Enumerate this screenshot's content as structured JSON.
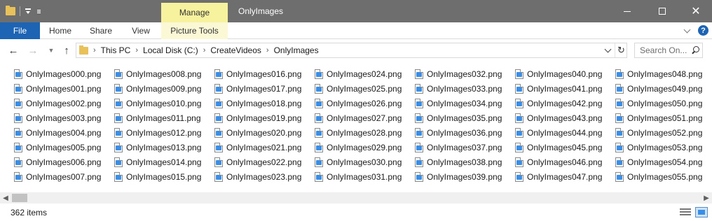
{
  "window": {
    "title": "OnlyImages",
    "contextual_tab_group": "Manage"
  },
  "ribbon": {
    "tabs": [
      "File",
      "Home",
      "Share",
      "View",
      "Picture Tools"
    ]
  },
  "navigation": {
    "breadcrumb": [
      "This PC",
      "Local Disk (C:)",
      "CreateVideos",
      "OnlyImages"
    ],
    "search_placeholder": "Search On..."
  },
  "files": [
    "OnlyImages000.png",
    "OnlyImages001.png",
    "OnlyImages002.png",
    "OnlyImages003.png",
    "OnlyImages004.png",
    "OnlyImages005.png",
    "OnlyImages006.png",
    "OnlyImages007.png",
    "OnlyImages008.png",
    "OnlyImages009.png",
    "OnlyImages010.png",
    "OnlyImages011.png",
    "OnlyImages012.png",
    "OnlyImages013.png",
    "OnlyImages014.png",
    "OnlyImages015.png",
    "OnlyImages016.png",
    "OnlyImages017.png",
    "OnlyImages018.png",
    "OnlyImages019.png",
    "OnlyImages020.png",
    "OnlyImages021.png",
    "OnlyImages022.png",
    "OnlyImages023.png",
    "OnlyImages024.png",
    "OnlyImages025.png",
    "OnlyImages026.png",
    "OnlyImages027.png",
    "OnlyImages028.png",
    "OnlyImages029.png",
    "OnlyImages030.png",
    "OnlyImages031.png",
    "OnlyImages032.png",
    "OnlyImages033.png",
    "OnlyImages034.png",
    "OnlyImages035.png",
    "OnlyImages036.png",
    "OnlyImages037.png",
    "OnlyImages038.png",
    "OnlyImages039.png",
    "OnlyImages040.png",
    "OnlyImages041.png",
    "OnlyImages042.png",
    "OnlyImages043.png",
    "OnlyImages044.png",
    "OnlyImages045.png",
    "OnlyImages046.png",
    "OnlyImages047.png",
    "OnlyImages048.png",
    "OnlyImages049.png",
    "OnlyImages050.png",
    "OnlyImages051.png",
    "OnlyImages052.png",
    "OnlyImages053.png",
    "OnlyImages054.png",
    "OnlyImages055.png"
  ],
  "status": {
    "item_count": "362 items"
  },
  "colors": {
    "titlebar": "#6e6e6e",
    "manage_tab": "#f7f29d",
    "file_tab": "#1e64b4"
  },
  "icons": {
    "file": "png-image-file-icon",
    "folder": "folder-icon",
    "search": "search-icon"
  }
}
